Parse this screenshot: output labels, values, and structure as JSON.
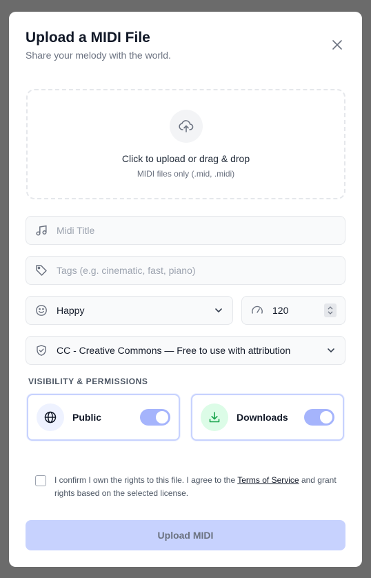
{
  "modal": {
    "title": "Upload a MIDI File",
    "subtitle": "Share your melody with the world."
  },
  "dropzone": {
    "main_text": "Click to upload or drag & drop",
    "hint": "MIDI files only (.mid, .midi)",
    "icon": "cloud-upload-icon"
  },
  "title_field": {
    "placeholder": "Midi Title",
    "value": "",
    "icon": "music-note-icon"
  },
  "tags_field": {
    "placeholder": "Tags (e.g. cinematic, fast, piano)",
    "value": "",
    "icon": "tag-icon"
  },
  "mood_select": {
    "selected": "Happy",
    "icon": "smiley-icon"
  },
  "tempo_input": {
    "value": "120",
    "icon": "speedometer-icon"
  },
  "license_select": {
    "selected": "CC - Creative Commons — Free to use with attribution",
    "icon": "shield-check-icon"
  },
  "permissions": {
    "heading": "VISIBILITY & PERMISSIONS",
    "public": {
      "label": "Public",
      "enabled": true,
      "icon": "globe-icon"
    },
    "downloads": {
      "label": "Downloads",
      "enabled": true,
      "icon": "download-icon"
    }
  },
  "confirm": {
    "text_before": "I confirm I own the rights to this file. I agree to the ",
    "link": "Terms of Service",
    "text_after": " and grant rights based on the selected license.",
    "checked": false
  },
  "submit_label": "Upload MIDI",
  "colors": {
    "accent_light": "#c7d2fe",
    "toggle_on": "#a5b4fc",
    "downloads_badge": "#dcfce7",
    "public_badge": "#eef2ff"
  }
}
